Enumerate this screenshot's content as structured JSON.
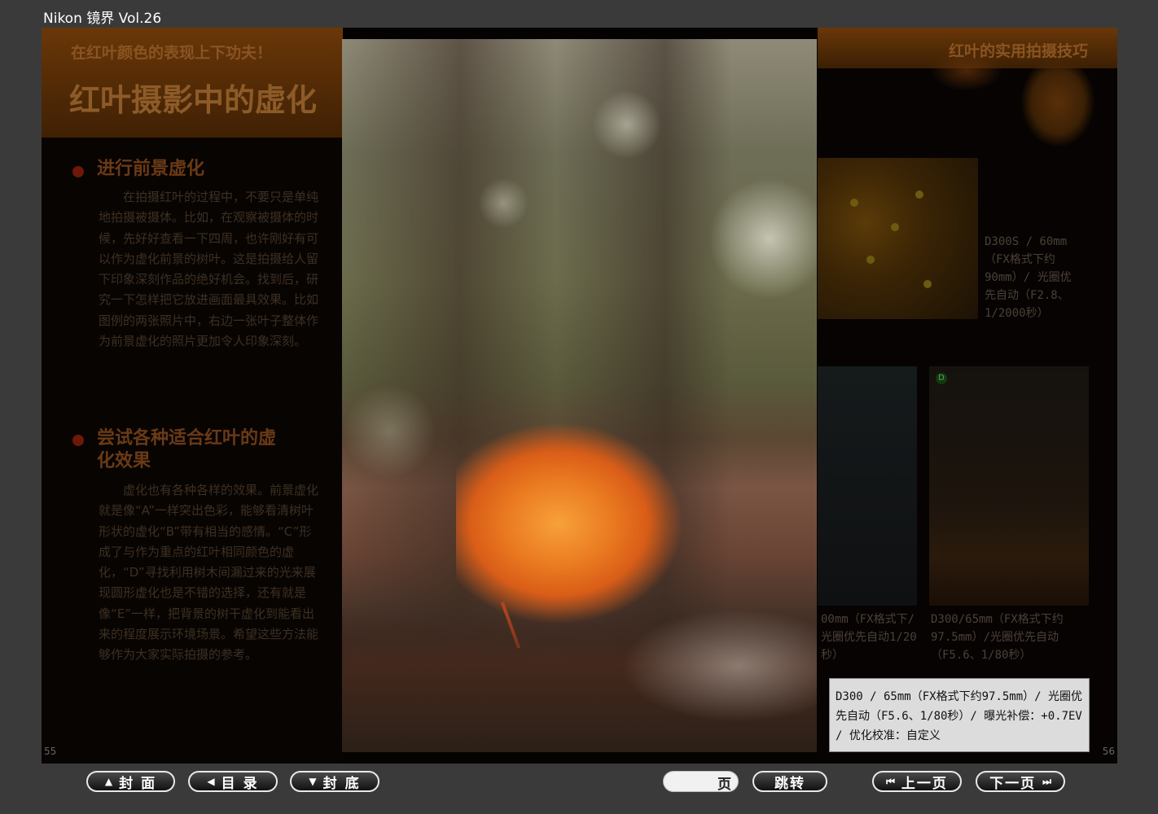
{
  "window": {
    "title": "Nikon 镜界 Vol.26"
  },
  "left_page": {
    "subtitle": "在红叶颜色的表现上下功夫！",
    "headline": "红叶摄影中的虚化",
    "sections": [
      {
        "heading": "进行前景虚化",
        "body": "在拍摄红叶的过程中，不要只是单纯地拍摄被摄体。比如，在观察被摄体的时候，先好好查看一下四周，也许刚好有可以作为虚化前景的树叶。这是拍摄给人留下印象深刻作品的绝好机会。找到后，研究一下怎样把它放进画面最具效果。比如图例的两张照片中，右边一张叶子整体作为前景虚化的照片更加令人印象深刻。"
      },
      {
        "heading": "尝试各种适合红叶的虚化效果",
        "body": "虚化也有各种各样的效果。前景虚化就是像“A”一样突出色彩，能够看清树叶形状的虚化“B”带有相当的感情。“C”形成了与作为重点的红叶相同颜色的虚化，“D”寻找利用树木间漏过来的光来展现圆形虚化也是不错的选择，还有就是像“E”一样，把背景的树干虚化到能看出来的程度展示环境场景。希望这些方法能够作为大家实际拍摄的参考。"
      }
    ],
    "page_number": "55"
  },
  "right_page": {
    "title": "红叶的实用拍摄技巧",
    "caption1": "D300S / 60mm（FX格式下约90mm）/ 光圈优先自动（F2.8、1/2000秒）",
    "caption2": "00mm（FX格式下/光圈优先自动1/20秒）",
    "caption3": "D300/65mm（FX格式下约97.5mm）/光圈优先自动（F5.6、1/80秒）",
    "thumb_badge": "D",
    "page_number": "56"
  },
  "popup": {
    "info": "D300 / 65mm（FX格式下约97.5mm）/ 光圈优先自动（F5.6、1/80秒）/ 曝光补偿：+0.7EV / 优化校准：自定义"
  },
  "toolbar": {
    "cover": "封 面",
    "contents": "目 录",
    "back_cover": "封 底",
    "page_input_value": "",
    "page_label": "页",
    "jump": "跳转",
    "prev": "上一页",
    "next": "下一页"
  }
}
